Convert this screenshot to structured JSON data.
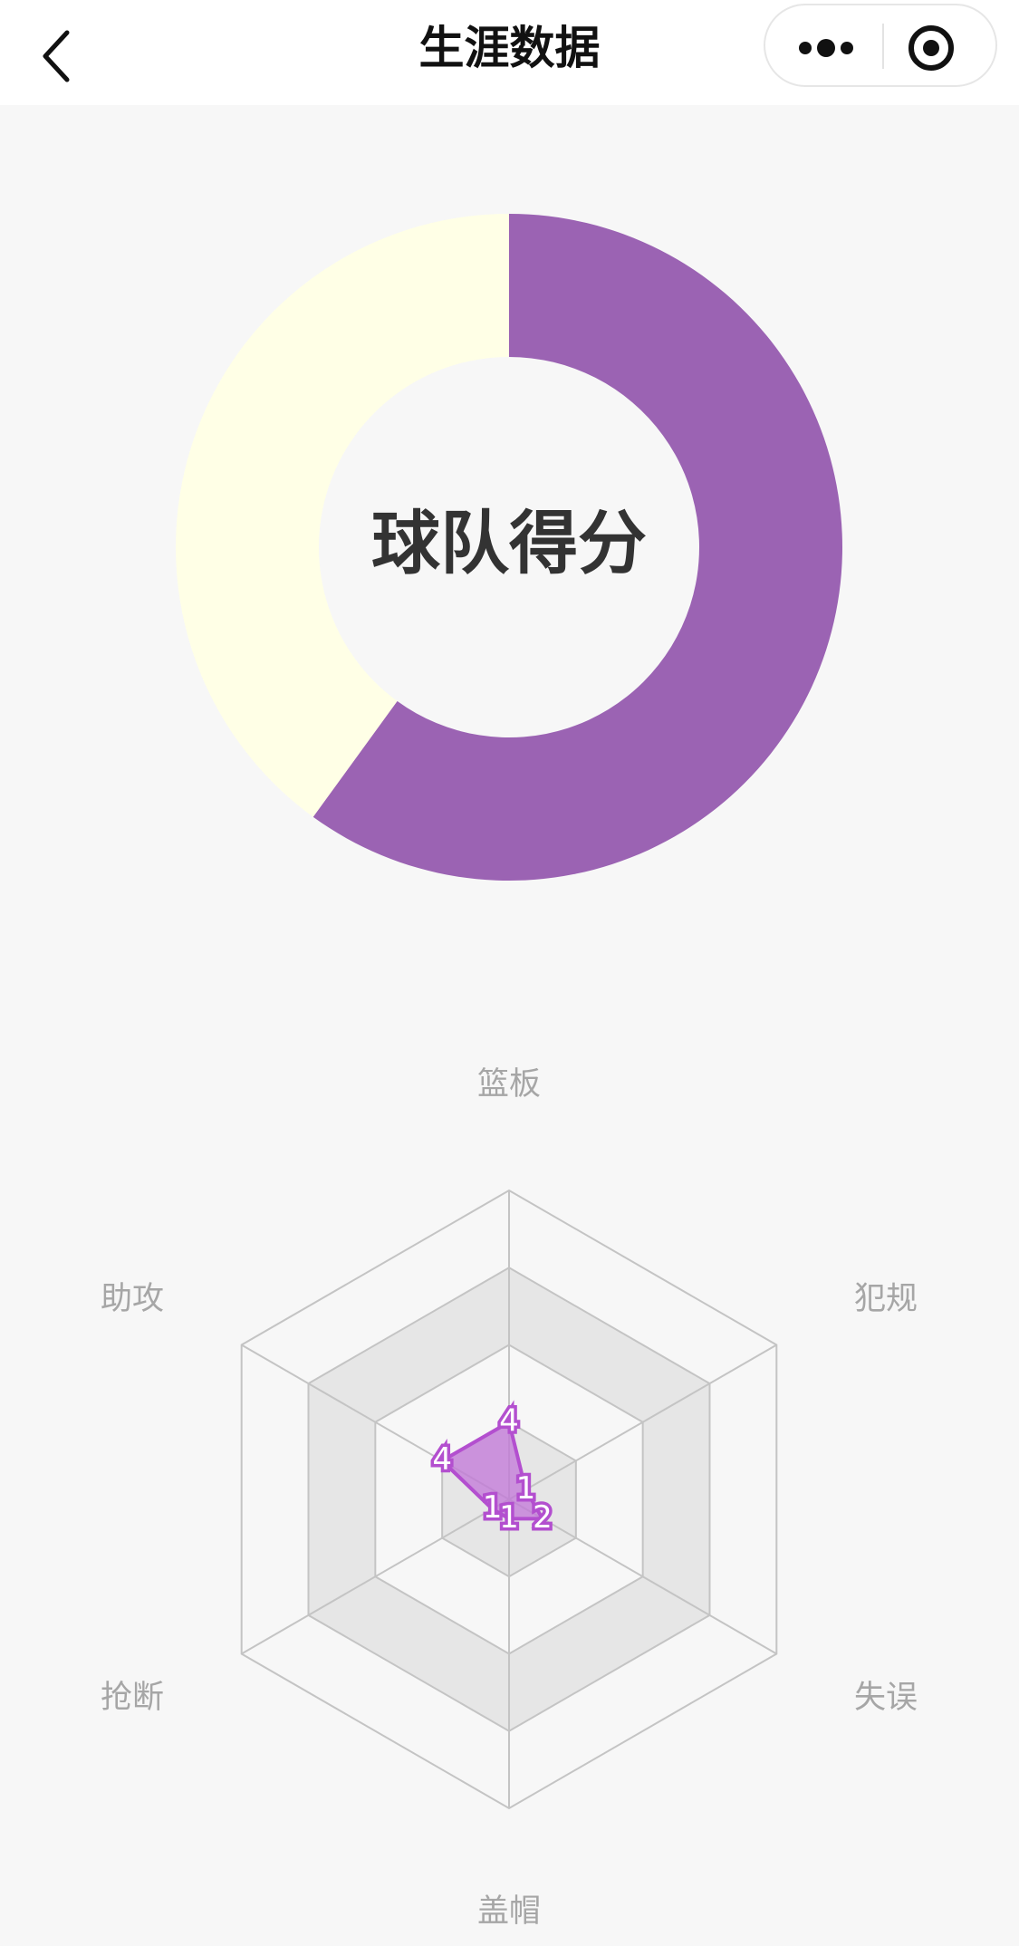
{
  "nav": {
    "title": "生涯数据",
    "back_icon": "chevron-left-icon",
    "more_icon": "more-dots-icon",
    "close_icon": "target-close-icon"
  },
  "chart_data": [
    {
      "type": "pie",
      "variant": "donut",
      "center_label": "球队得分",
      "slices": [
        {
          "value": 60,
          "color": "#9b63b3"
        },
        {
          "value": 40,
          "color": "#ffffe6"
        }
      ]
    },
    {
      "type": "radar",
      "axes": [
        "篮板",
        "犯规",
        "失误",
        "盖帽",
        "抢断",
        "助攻"
      ],
      "values": [
        4,
        1,
        2,
        1,
        1,
        4
      ],
      "max": 16,
      "levels": 4,
      "series_color": "#c275d8",
      "grid": true
    }
  ]
}
